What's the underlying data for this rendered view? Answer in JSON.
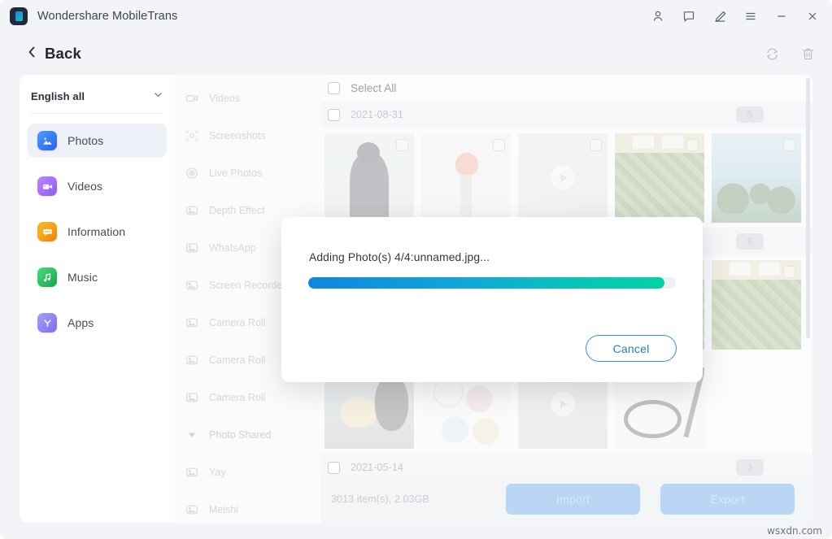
{
  "titlebar": {
    "app_name": "Wondershare MobileTrans",
    "logo_icon": "mobiletrans-logo-icon",
    "controls": [
      {
        "name": "account-icon",
        "label": "Account"
      },
      {
        "name": "feedback-icon",
        "label": "Feedback"
      },
      {
        "name": "edit-pen-icon",
        "label": "Edit"
      },
      {
        "name": "menu-icon",
        "label": "Menu"
      },
      {
        "name": "minimize-icon",
        "label": "Minimize"
      },
      {
        "name": "close-icon",
        "label": "Close"
      }
    ]
  },
  "subheader": {
    "back_label": "Back",
    "back_icon": "chevron-left-icon",
    "actions": [
      {
        "name": "refresh-icon",
        "label": "Refresh"
      },
      {
        "name": "trash-icon",
        "label": "Delete"
      }
    ]
  },
  "sidebar": {
    "language_selector": {
      "value": "English all",
      "caret_icon": "chevron-down-icon"
    },
    "items": [
      {
        "label": "Photos",
        "icon": "photos-icon",
        "color": "#3b82f6",
        "active": true
      },
      {
        "label": "Videos",
        "icon": "videos-icon",
        "color": "#a855f7",
        "active": false
      },
      {
        "label": "Information",
        "icon": "information-icon",
        "color": "#f59e0b",
        "active": false
      },
      {
        "label": "Music",
        "icon": "music-icon",
        "color": "#22c55e",
        "active": false
      },
      {
        "label": "Apps",
        "icon": "apps-icon",
        "color": "#8b7bf0",
        "active": false
      }
    ]
  },
  "categories": [
    {
      "label": "Videos",
      "icon": "video-camera-icon",
      "type": "item"
    },
    {
      "label": "Screenshots",
      "icon": "screenshot-icon",
      "type": "item"
    },
    {
      "label": "Live Photos",
      "icon": "live-photo-icon",
      "type": "item"
    },
    {
      "label": "Depth Effect",
      "icon": "photo-icon",
      "type": "item"
    },
    {
      "label": "WhatsApp",
      "icon": "photo-icon",
      "type": "item"
    },
    {
      "label": "Screen Recorder",
      "icon": "photo-icon",
      "type": "item"
    },
    {
      "label": "Camera Roll",
      "icon": "photo-icon",
      "type": "item"
    },
    {
      "label": "Camera Roll",
      "icon": "photo-icon",
      "type": "item"
    },
    {
      "label": "Camera Roll",
      "icon": "photo-icon",
      "type": "item"
    },
    {
      "label": "Photo Shared",
      "icon": "caret-down-icon",
      "type": "group"
    },
    {
      "label": "Yay",
      "icon": "photo-icon",
      "type": "item"
    },
    {
      "label": "Meishi",
      "icon": "photo-icon",
      "type": "item"
    }
  ],
  "content": {
    "select_all_label": "Select All",
    "groups": [
      {
        "date": "2021-08-31",
        "count": "5",
        "thumbs": [
          {
            "art": "art-person",
            "kind": "photo"
          },
          {
            "art": "art-flower",
            "kind": "photo"
          },
          {
            "art": "art-video",
            "kind": "video"
          },
          {
            "art": "art-green",
            "kind": "photo"
          },
          {
            "art": "art-beach",
            "kind": "photo"
          }
        ]
      },
      {
        "date": "",
        "count": "9",
        "thumbs": [
          {
            "art": "art-person",
            "kind": "photo"
          },
          {
            "art": "art-flower",
            "kind": "photo"
          },
          {
            "art": "art-video",
            "kind": "video"
          },
          {
            "art": "art-green",
            "kind": "photo"
          },
          {
            "art": "art-green",
            "kind": "photo"
          }
        ]
      },
      {
        "date": "",
        "count": "",
        "thumbs": [
          {
            "art": "art-umbrella",
            "kind": "photo"
          },
          {
            "art": "art-diagram",
            "kind": "photo"
          },
          {
            "art": "art-gray",
            "kind": "video"
          },
          {
            "art": "art-cable",
            "kind": "photo"
          }
        ]
      },
      {
        "date": "2021-05-14",
        "count": "3",
        "thumbs": []
      }
    ]
  },
  "bottombar": {
    "items_info": "3013 item(s), 2.03GB",
    "import_label": "Import",
    "export_label": "Export"
  },
  "modal": {
    "message": "Adding Photo(s) 4/4:unnamed.jpg...",
    "progress_percent": 97,
    "cancel_label": "Cancel",
    "progress_start_color": "#0e86e0",
    "progress_end_color": "#00d2a4"
  },
  "watermark": "wsxdn.com"
}
